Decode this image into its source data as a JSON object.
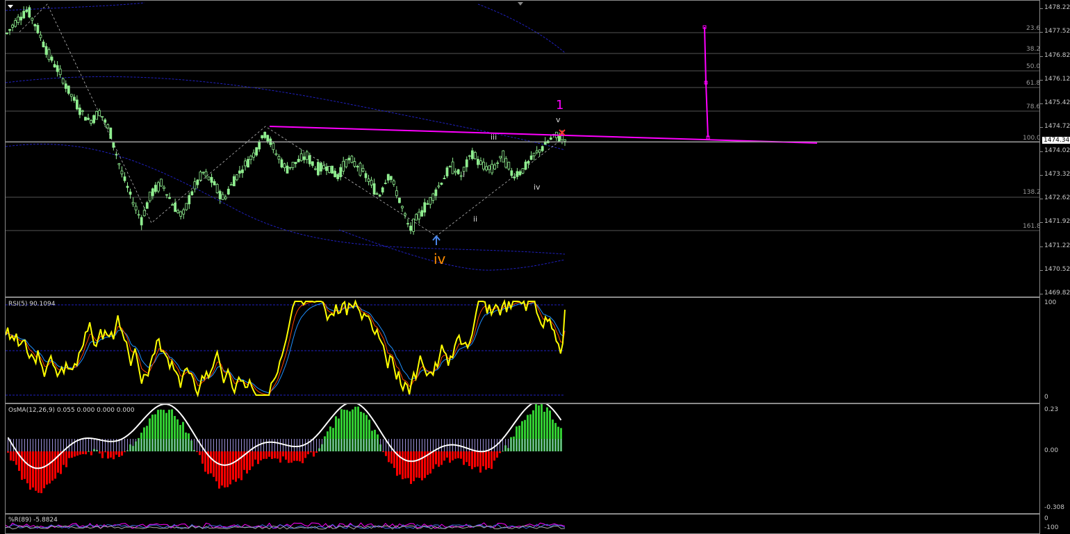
{
  "main": {
    "price_ticks": [
      "1478.22",
      "1477.52",
      "1476.82",
      "1476.12",
      "1475.42",
      "1474.72",
      "1474.02",
      "1473.32",
      "1472.62",
      "1471.92",
      "1471.22",
      "1470.52",
      "1469.82"
    ],
    "current_price": "1474.34",
    "fib_labels": [
      "23.6",
      "38.2",
      "50.0",
      "61.8",
      "78.6",
      "100.0",
      "138.2",
      "161.8"
    ],
    "wave_labels": {
      "major_iv": "iv",
      "major_1": "1",
      "minor_i": "i",
      "minor_ii": "ii",
      "minor_iii": "iii",
      "minor_iv": "iv",
      "minor_v": "v"
    }
  },
  "rsi": {
    "title": "RSI(5) 90.1094",
    "ticks": [
      "100",
      "0"
    ]
  },
  "osma": {
    "title": "OsMA(12,26,9) 0.055 0.000 0.000 0.000",
    "ticks": [
      "0.23",
      "0.00",
      "-0.308"
    ]
  },
  "wpr": {
    "title": "%R(89) -5.8824",
    "ticks": [
      "0",
      "-100"
    ]
  },
  "colors": {
    "bull_candle": "#90ee90",
    "trendline": "#ff00ff",
    "channel": "#2020c0",
    "rsi_line": "#ffff00",
    "osma_up": "#32cd32",
    "osma_down": "#ff0000",
    "wave_iv": "#ff8c00",
    "wave_1": "#ff00ff"
  },
  "chart_data": {
    "type": "line",
    "title": "",
    "price_range": [
      1469.82,
      1478.22
    ],
    "close_path": [
      1477.5,
      1477.9,
      1478.2,
      1477.6,
      1476.9,
      1476.4,
      1475.8,
      1475.3,
      1474.9,
      1475.2,
      1474.6,
      1473.5,
      1472.7,
      1472.0,
      1472.8,
      1473.1,
      1472.5,
      1472.1,
      1472.9,
      1473.4,
      1473.1,
      1472.6,
      1473.2,
      1473.6,
      1474.0,
      1474.6,
      1474.0,
      1473.5,
      1473.7,
      1473.9,
      1473.5,
      1473.6,
      1473.3,
      1473.8,
      1473.6,
      1473.2,
      1472.7,
      1473.4,
      1472.6,
      1471.7,
      1472.2,
      1472.6,
      1473.1,
      1473.6,
      1473.3,
      1474.0,
      1473.6,
      1473.5,
      1473.9,
      1473.3,
      1473.5,
      1473.9,
      1474.2,
      1474.5,
      1474.4
    ],
    "rsi_range": [
      0,
      100
    ],
    "osma_range": [
      -0.308,
      0.23
    ],
    "wpr_range": [
      -100,
      0
    ],
    "rsi_value": 90.1094,
    "osma_value": 0.055,
    "wpr_value": -5.8824
  }
}
